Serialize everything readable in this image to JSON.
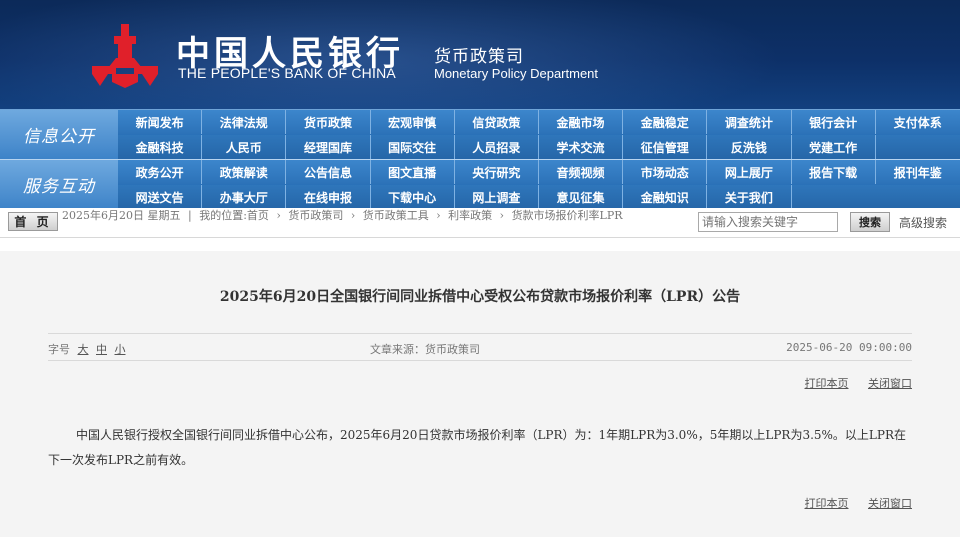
{
  "header": {
    "bank_name_cn": "中国人民银行",
    "bank_name_en": "THE PEOPLE'S BANK OF CHINA",
    "dept_cn": "货币政策司",
    "dept_en": "Monetary Policy Department",
    "logo_icon": "pboc-logo-icon",
    "logo_color": "#e0202a"
  },
  "nav": {
    "section1_label": "信息公开",
    "section2_label": "服务互动",
    "row1": [
      "新闻发布",
      "法律法规",
      "货币政策",
      "宏观审慎",
      "信贷政策",
      "金融市场",
      "金融稳定",
      "调查统计",
      "银行会计",
      "支付体系"
    ],
    "row2": [
      "金融科技",
      "人民币",
      "经理国库",
      "国际交往",
      "人员招录",
      "学术交流",
      "征信管理",
      "反洗钱",
      "党建工作",
      ""
    ],
    "row3": [
      "政务公开",
      "政策解读",
      "公告信息",
      "图文直播",
      "央行研究",
      "音频视频",
      "市场动态",
      "网上展厅",
      "报告下载",
      "报刊年鉴"
    ],
    "row4": [
      "网送文告",
      "办事大厅",
      "在线申报",
      "下载中心",
      "网上调查",
      "意见征集",
      "金融知识",
      "关于我们",
      "",
      ""
    ]
  },
  "breadcrumb": {
    "home_label": "首 页",
    "date": "2025年6月20日 星期五",
    "location_prefix": "我的位置:首页",
    "items": [
      "货币政策司",
      "货币政策工具",
      "利率政策",
      "货款市场报价利率LPR"
    ]
  },
  "search": {
    "placeholder": "请输入搜索关键字",
    "button_label": "搜索",
    "advanced_label": "高级搜索"
  },
  "article": {
    "title": "2025年6月20日全国银行间同业拆借中心受权公布贷款市场报价利率（LPR）公告",
    "font_size_label": "字号",
    "font_sizes": [
      "大",
      "中",
      "小"
    ],
    "source": "文章来源：货币政策司",
    "datetime": "2025-06-20 09:00:00",
    "print_label": "打印本页",
    "close_label": "关闭窗口",
    "body": "中国人民银行授权全国银行间同业拆借中心公布，2025年6月20日贷款市场报价利率（LPR）为：1年期LPR为3.0%，5年期以上LPR为3.5%。以上LPR在下一次发布LPR之前有效。"
  }
}
